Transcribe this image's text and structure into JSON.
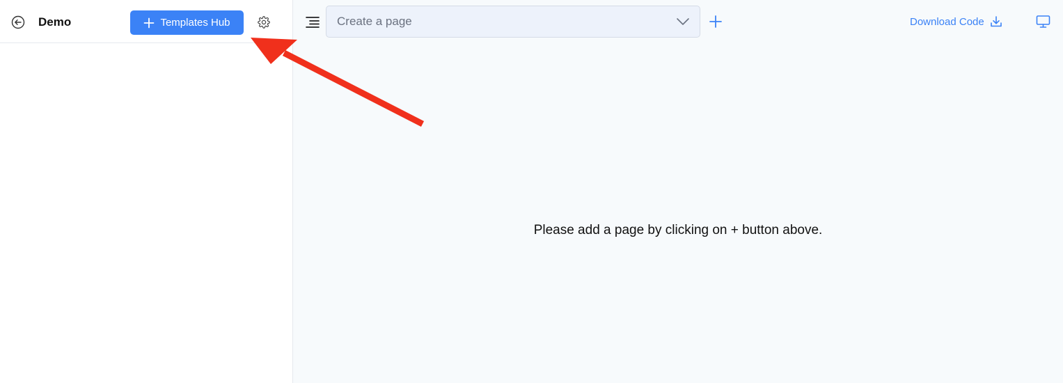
{
  "sidebar": {
    "back_icon": "arrow-left-circle-icon",
    "project_name": "Demo",
    "templates_button": {
      "label": "Templates Hub",
      "icon": "plus-icon"
    },
    "settings_icon": "gear-icon"
  },
  "toolbar": {
    "menu_icon": "menu-lines-icon",
    "page_select": {
      "placeholder": "Create a page",
      "icon": "chevron-down-icon"
    },
    "add_page_icon": "plus-icon",
    "download": {
      "label": "Download Code",
      "icon": "download-icon"
    },
    "preview_icon": "monitor-icon"
  },
  "main": {
    "empty_message": "Please add a page by clicking on + button above."
  },
  "annotation": {
    "type": "arrow",
    "color": "#f0301c"
  },
  "colors": {
    "accent": "#3b82f6",
    "sidebar_bg": "#ffffff",
    "main_bg": "#f7fafc",
    "select_bg": "#edf2fb"
  }
}
